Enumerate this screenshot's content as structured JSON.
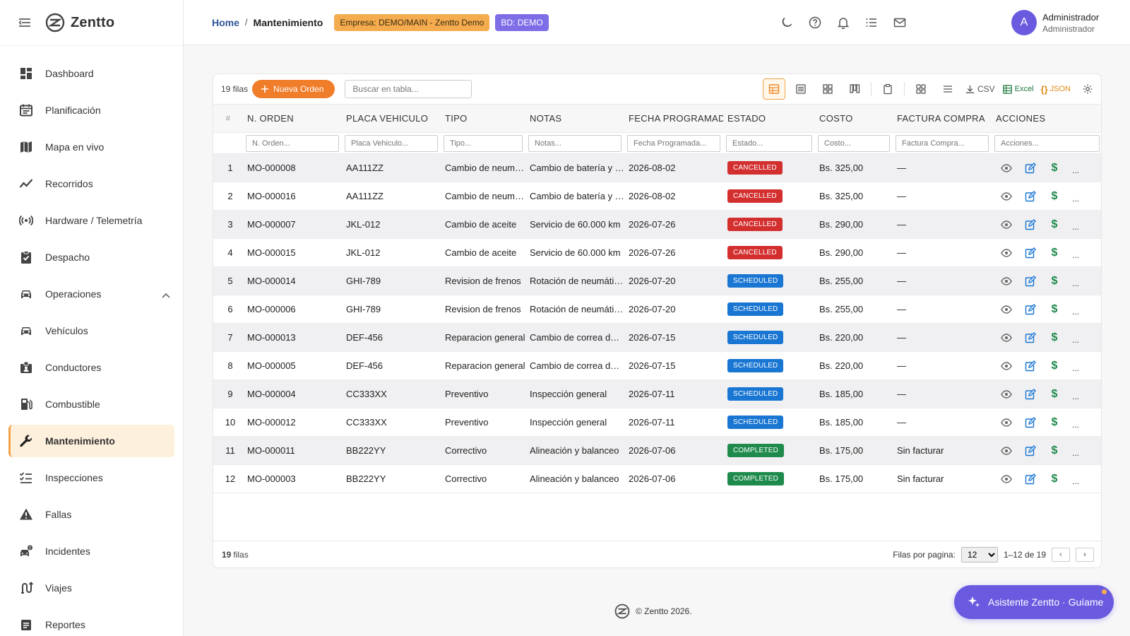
{
  "app": {
    "brand": "Zentto"
  },
  "sidebar": {
    "items": [
      {
        "label": "Dashboard",
        "icon": "dashboard-icon"
      },
      {
        "label": "Planificación",
        "icon": "calendar-icon"
      },
      {
        "label": "Mapa en vivo",
        "icon": "map-icon"
      },
      {
        "label": "Recorridos",
        "icon": "trend-line-icon"
      },
      {
        "label": "Hardware / Telemetría",
        "icon": "radio-signal-icon"
      },
      {
        "label": "Despacho",
        "icon": "clipboard-check-icon"
      },
      {
        "label": "Operaciones",
        "icon": "car-icon"
      },
      {
        "label": "Vehículos",
        "icon": "car-icon"
      },
      {
        "label": "Conductores",
        "icon": "id-badge-icon"
      },
      {
        "label": "Combustible",
        "icon": "fuel-pump-icon"
      },
      {
        "label": "Mantenimiento",
        "icon": "wrench-icon"
      },
      {
        "label": "Inspecciones",
        "icon": "checklist-icon"
      },
      {
        "label": "Fallas",
        "icon": "warning-icon"
      },
      {
        "label": "Incidentes",
        "icon": "car-crash-icon"
      },
      {
        "label": "Viajes",
        "icon": "route-icon"
      },
      {
        "label": "Reportes",
        "icon": "report-icon"
      }
    ],
    "active_index": 10
  },
  "header": {
    "breadcrumb_home": "Home",
    "breadcrumb_sep": "/",
    "breadcrumb_current": "Mantenimiento",
    "empresa_badge": "Empresa: DEMO/MAIN - Zentto Demo",
    "bd_badge": "BD: DEMO",
    "user_initial": "A",
    "user_name": "Administrador",
    "user_role": "Administrador"
  },
  "toolbar": {
    "rows_label": "19 filas",
    "new_button": "Nueva Orden",
    "search_placeholder": "Buscar en tabla...",
    "csv_label": "CSV",
    "excel_label": "Excel",
    "json_label": "JSON"
  },
  "table": {
    "columns": [
      "#",
      "N. ORDEN",
      "PLACA VEHICULO",
      "TIPO",
      "NOTAS",
      "FECHA PROGRAMADA",
      "ESTADO",
      "COSTO",
      "FACTURA COMPRA",
      "ACCIONES"
    ],
    "filters": [
      "N. Orden...",
      "Placa Vehiculo...",
      "Tipo...",
      "Notas...",
      "Fecha Programada...",
      "Estado...",
      "Costo...",
      "Factura Compra...",
      "Acciones..."
    ],
    "rows": [
      {
        "n": "1",
        "orden": "MO-000008",
        "placa": "AA111ZZ",
        "tipo": "Cambio de neumáticos",
        "notas": "Cambio de batería y revisión",
        "fecha": "2026-08-02",
        "estado": "CANCELLED",
        "costo": "Bs. 325,00",
        "factura": "—"
      },
      {
        "n": "2",
        "orden": "MO-000016",
        "placa": "AA111ZZ",
        "tipo": "Cambio de neumáticos",
        "notas": "Cambio de batería y revisión",
        "fecha": "2026-08-02",
        "estado": "CANCELLED",
        "costo": "Bs. 325,00",
        "factura": "—"
      },
      {
        "n": "3",
        "orden": "MO-000007",
        "placa": "JKL-012",
        "tipo": "Cambio de aceite",
        "notas": "Servicio de 60.000 km",
        "fecha": "2026-07-26",
        "estado": "CANCELLED",
        "costo": "Bs. 290,00",
        "factura": "—"
      },
      {
        "n": "4",
        "orden": "MO-000015",
        "placa": "JKL-012",
        "tipo": "Cambio de aceite",
        "notas": "Servicio de 60.000 km",
        "fecha": "2026-07-26",
        "estado": "CANCELLED",
        "costo": "Bs. 290,00",
        "factura": "—"
      },
      {
        "n": "5",
        "orden": "MO-000014",
        "placa": "GHI-789",
        "tipo": "Revision de frenos",
        "notas": "Rotación de neumáticos",
        "fecha": "2026-07-20",
        "estado": "SCHEDULED",
        "costo": "Bs. 255,00",
        "factura": "—"
      },
      {
        "n": "6",
        "orden": "MO-000006",
        "placa": "GHI-789",
        "tipo": "Revision de frenos",
        "notas": "Rotación de neumáticos",
        "fecha": "2026-07-20",
        "estado": "SCHEDULED",
        "costo": "Bs. 255,00",
        "factura": "—"
      },
      {
        "n": "7",
        "orden": "MO-000013",
        "placa": "DEF-456",
        "tipo": "Reparacion general",
        "notas": "Cambio de correa de distribución",
        "fecha": "2026-07-15",
        "estado": "SCHEDULED",
        "costo": "Bs. 220,00",
        "factura": "—"
      },
      {
        "n": "8",
        "orden": "MO-000005",
        "placa": "DEF-456",
        "tipo": "Reparacion general",
        "notas": "Cambio de correa de distribución",
        "fecha": "2026-07-15",
        "estado": "SCHEDULED",
        "costo": "Bs. 220,00",
        "factura": "—"
      },
      {
        "n": "9",
        "orden": "MO-000004",
        "placa": "CC333XX",
        "tipo": "Preventivo",
        "notas": "Inspección general",
        "fecha": "2026-07-11",
        "estado": "SCHEDULED",
        "costo": "Bs. 185,00",
        "factura": "—"
      },
      {
        "n": "10",
        "orden": "MO-000012",
        "placa": "CC333XX",
        "tipo": "Preventivo",
        "notas": "Inspección general",
        "fecha": "2026-07-11",
        "estado": "SCHEDULED",
        "costo": "Bs. 185,00",
        "factura": "—"
      },
      {
        "n": "11",
        "orden": "MO-000011",
        "placa": "BB222YY",
        "tipo": "Correctivo",
        "notas": "Alineación y balanceo",
        "fecha": "2026-07-06",
        "estado": "COMPLETED",
        "costo": "Bs. 175,00",
        "factura": "Sin facturar"
      },
      {
        "n": "12",
        "orden": "MO-000003",
        "placa": "BB222YY",
        "tipo": "Correctivo",
        "notas": "Alineación y balanceo",
        "fecha": "2026-07-06",
        "estado": "COMPLETED",
        "costo": "Bs. 175,00",
        "factura": "Sin facturar"
      }
    ]
  },
  "footer": {
    "count": "19",
    "count_suffix": "filas",
    "per_page_label": "Filas por pagina:",
    "per_page_value": "12",
    "range": "1–12 de 19",
    "prev": "‹",
    "next": "›"
  },
  "copyright": "© Zentto 2026.",
  "assistant_button": "Asistente Zentto · Guíame",
  "colors": {
    "accent": "#f07d2a",
    "purple": "#6a5ae0",
    "cancelled": "#d32f2f",
    "scheduled": "#1976d2",
    "completed": "#1e8a4c"
  }
}
